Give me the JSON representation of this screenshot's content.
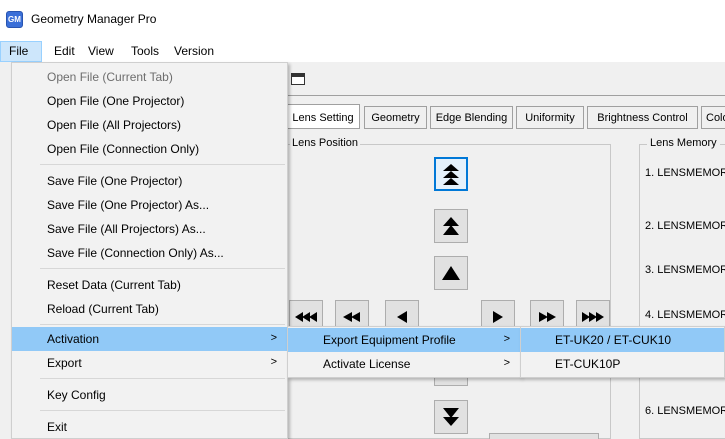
{
  "window": {
    "title": "Geometry Manager Pro",
    "icon_label": "GM"
  },
  "menubar": [
    "File",
    "Edit",
    "View",
    "Tools",
    "Version"
  ],
  "tabs": [
    "Lens Setting",
    "Geometry",
    "Edge Blending",
    "Uniformity",
    "Brightness Control",
    "Colo"
  ],
  "lens_position": {
    "label": "Lens Position"
  },
  "lens_memory": {
    "label": "Lens Memory",
    "items": [
      "1. LENSMEMOR",
      "2. LENSMEMOR",
      "3. LENSMEMOR",
      "4. LENSMEMOR",
      "6. LENSMEMOR"
    ]
  },
  "file_menu": [
    {
      "label": "Open File (Current Tab)",
      "disabled": true
    },
    {
      "label": "Open File (One Projector)"
    },
    {
      "label": "Open File (All Projectors)"
    },
    {
      "label": "Open File (Connection Only)"
    },
    {
      "label": "Save File (One Projector)"
    },
    {
      "label": "Save File (One Projector) As..."
    },
    {
      "label": "Save File (All Projectors) As..."
    },
    {
      "label": "Save File (Connection Only) As..."
    },
    {
      "label": "Reset Data (Current Tab)"
    },
    {
      "label": "Reload (Current Tab)"
    },
    {
      "label": "Activation",
      "submenu": true,
      "highlighted": true
    },
    {
      "label": "Export",
      "submenu": true
    },
    {
      "label": "Key Config"
    },
    {
      "label": "Exit"
    }
  ],
  "activation_menu": [
    {
      "label": "Export Equipment Profile",
      "submenu": true,
      "highlighted": true
    },
    {
      "label": "Activate License",
      "submenu": true
    }
  ],
  "export_profile_menu": [
    {
      "label": "ET-UK20 / ET-CUK10",
      "highlighted": true
    },
    {
      "label": "ET-CUK10P"
    }
  ],
  "submenu_arrow": ">",
  "colors": {
    "highlight": "#91c9f7",
    "menu_bg": "#f2f2f2",
    "focus_border": "#0078d7"
  }
}
